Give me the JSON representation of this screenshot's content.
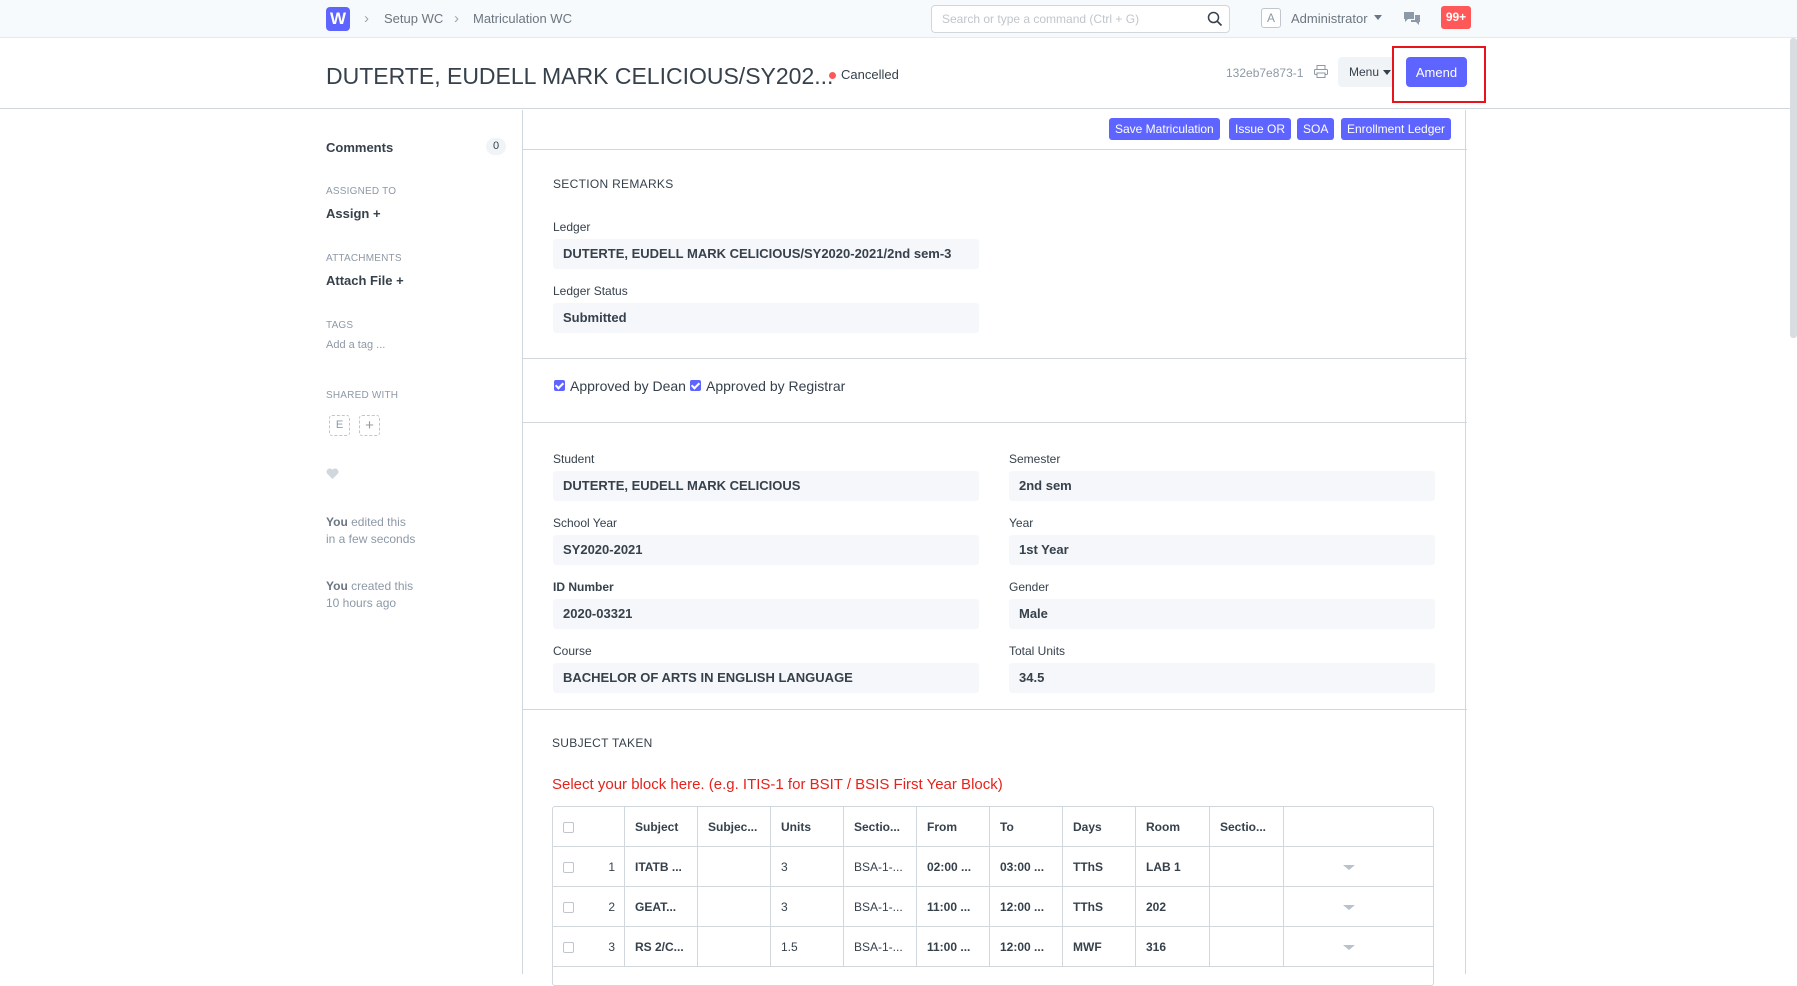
{
  "navbar": {
    "logo_letter": "W",
    "breadcrumbs": [
      "Setup WC",
      "Matriculation WC"
    ],
    "search_placeholder": "Search or type a command (Ctrl + G)",
    "user_avatar_letter": "A",
    "user_name": "Administrator",
    "notification_count": "99+",
    "accent_color": "#5e64ff",
    "alert_color": "#ff5858"
  },
  "page_head": {
    "title": "DUTERTE, EUDELL MARK CELICIOUS/SY202...",
    "status": "Cancelled",
    "doc_id": "132eb7e873-1",
    "menu_label": "Menu",
    "amend_label": "Amend"
  },
  "sidebar": {
    "comments_label": "Comments",
    "comments_count": "0",
    "assigned_to_label": "ASSIGNED TO",
    "assign_label": "Assign",
    "attachments_label": "ATTACHMENTS",
    "attach_label": "Attach File",
    "tags_label": "TAGS",
    "add_tag_label": "Add a tag ...",
    "shared_with_label": "SHARED WITH",
    "shared_avatar_letter": "E",
    "activity": [
      {
        "who": "You",
        "action": "edited this",
        "when": "in a few seconds"
      },
      {
        "who": "You",
        "action": "created this",
        "when": "10 hours ago"
      }
    ]
  },
  "toolbar": {
    "buttons": [
      "Save Matriculation",
      "Issue OR",
      "SOA",
      "Enrollment Ledger"
    ]
  },
  "section_remarks": {
    "title": "SECTION REMARKS",
    "ledger_label": "Ledger",
    "ledger_value": "DUTERTE, EUDELL MARK CELICIOUS/SY2020-2021/2nd sem-3",
    "ledger_status_label": "Ledger Status",
    "ledger_status_value": "Submitted"
  },
  "approvals": {
    "dean_label": "Approved by Dean",
    "registrar_label": "Approved by Registrar",
    "dean_checked": true,
    "registrar_checked": true
  },
  "student_info": {
    "student_label": "Student",
    "student_value": "DUTERTE, EUDELL MARK CELICIOUS",
    "school_year_label": "School Year",
    "school_year_value": "SY2020-2021",
    "id_number_label": "ID Number",
    "id_number_value": "2020-03321",
    "course_label": "Course",
    "course_value": "BACHELOR OF ARTS IN ENGLISH LANGUAGE",
    "semester_label": "Semester",
    "semester_value": "2nd sem",
    "year_label": "Year",
    "year_value": "1st Year",
    "gender_label": "Gender",
    "gender_value": "Male",
    "total_units_label": "Total Units",
    "total_units_value": "34.5"
  },
  "subject_taken": {
    "title": "SUBJECT TAKEN",
    "hint": "Select your block here. (e.g. ITIS-1 for BSIT / BSIS First Year Block)",
    "columns": [
      "Subject",
      "Subjec...",
      "Units",
      "Sectio...",
      "From",
      "To",
      "Days",
      "Room",
      "Sectio..."
    ],
    "rows": [
      {
        "idx": "1",
        "subject": "ITATB ...",
        "subject_desc": "",
        "units": "3",
        "section": "BSA-1-...",
        "from": "02:00 ...",
        "to": "03:00 ...",
        "days": "TThS",
        "room": "LAB 1",
        "section2": ""
      },
      {
        "idx": "2",
        "subject": "GEAT...",
        "subject_desc": "",
        "units": "3",
        "section": "BSA-1-...",
        "from": "11:00 ...",
        "to": "12:00 ...",
        "days": "TThS",
        "room": "202",
        "section2": ""
      },
      {
        "idx": "3",
        "subject": "RS 2/C...",
        "subject_desc": "",
        "units": "1.5",
        "section": "BSA-1-...",
        "from": "11:00 ...",
        "to": "12:00 ...",
        "days": "MWF",
        "room": "316",
        "section2": ""
      }
    ]
  }
}
